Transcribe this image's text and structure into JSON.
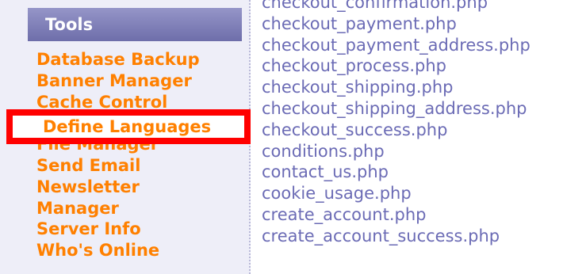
{
  "sidebar": {
    "header": "Tools",
    "items": [
      "Database Backup",
      "Banner Manager",
      "Cache Control",
      "Define Languages",
      "File Manager",
      "Send Email",
      "Newsletter",
      "Manager",
      "Server Info",
      "Who's Online"
    ]
  },
  "files": [
    "checkout_confirmation.php",
    "checkout_payment.php",
    "checkout_payment_address.php",
    "checkout_process.php",
    "checkout_shipping.php",
    "checkout_shipping_address.php",
    "checkout_success.php",
    "conditions.php",
    "contact_us.php",
    "cookie_usage.php",
    "create_account.php",
    "create_account_success.php"
  ],
  "colors": {
    "menu_text": "#ff8000",
    "file_text": "#6b6bb5",
    "header_bg": "#7e7eb8",
    "highlight_border": "#ff0000"
  }
}
